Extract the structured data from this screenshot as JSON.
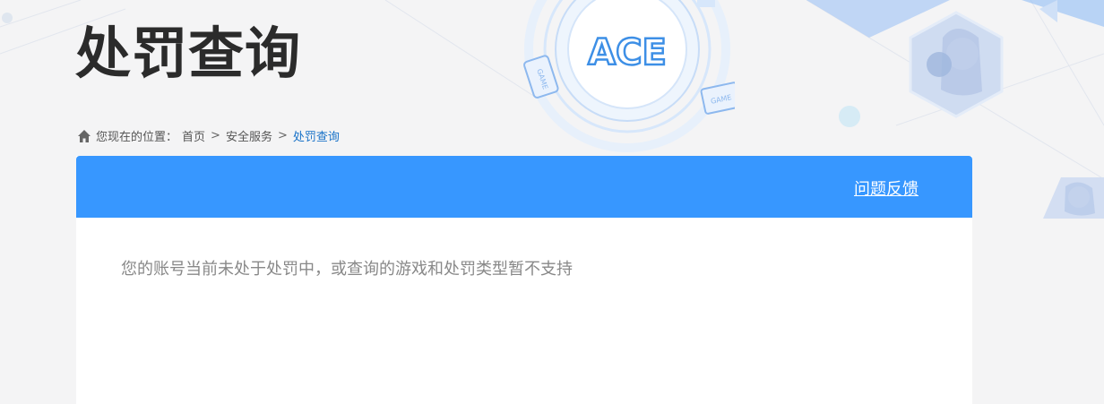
{
  "page": {
    "title": "处罚查询"
  },
  "breadcrumb": {
    "prefix": "您现在的位置：",
    "items": [
      "首页",
      "安全服务",
      "处罚查询"
    ],
    "separator": ">"
  },
  "header": {
    "logo_text": "ACE",
    "game_badge": "GAME",
    "feedback_label": "问题反馈"
  },
  "content": {
    "notice": "您的账号当前未处于处罚中，或查询的游戏和处罚类型暂不支持"
  },
  "colors": {
    "accent": "#3797ff",
    "breadcrumb_current": "#1a73c8",
    "title": "#2b2b2b",
    "notice_text": "#888888"
  }
}
